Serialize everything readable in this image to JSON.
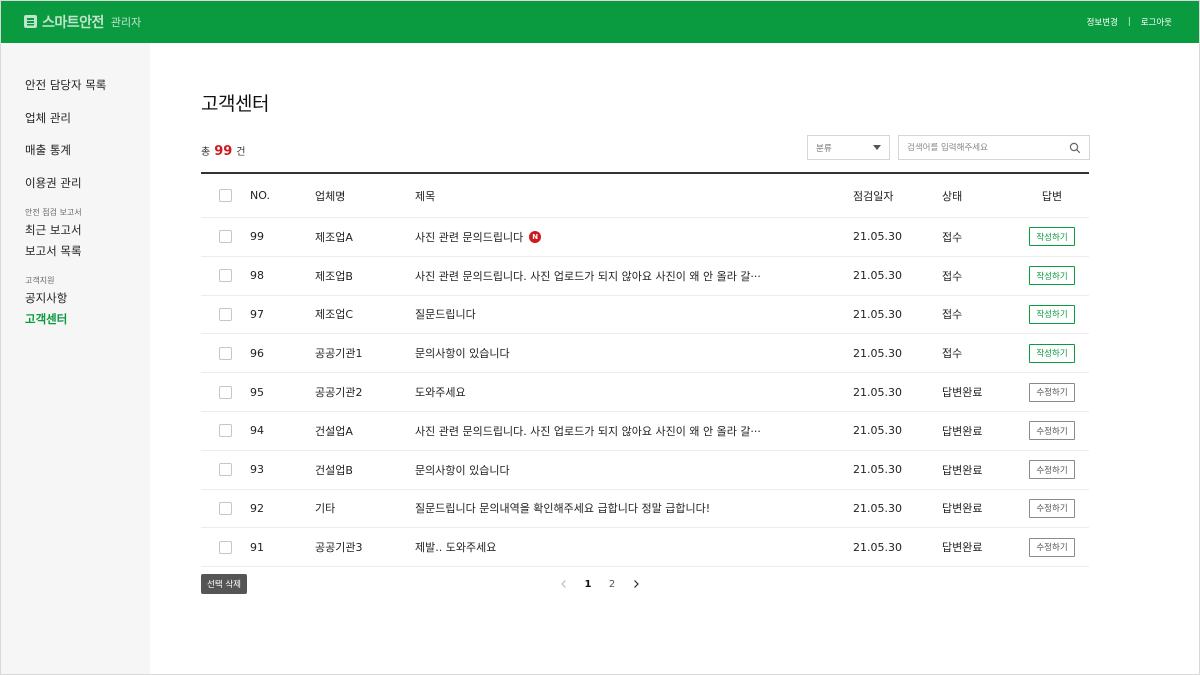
{
  "header": {
    "brand": "스마트안전",
    "brand_sub": "관리자",
    "links": {
      "profile": "정보변경",
      "separator": "|",
      "logout": "로그아웃"
    },
    "bg_color": "#0a9a3f"
  },
  "sidebar": {
    "items": [
      {
        "label": "안전 담당자 목록"
      },
      {
        "label": "업체 관리"
      },
      {
        "label": "매출 통계"
      },
      {
        "label": "이용권 관리"
      }
    ],
    "groups": [
      {
        "title": "안전 점검 보고서",
        "items": [
          "최근 보고서",
          "보고서 목록"
        ]
      },
      {
        "title": "고객지원",
        "items": [
          "공지사항",
          "고객센터"
        ]
      }
    ],
    "active": "고객센터"
  },
  "main": {
    "title": "고객센터",
    "total_prefix": "총",
    "total_count": "99",
    "total_suffix": "건",
    "filter_select": "분류",
    "search_placeholder": "검색어를 입력해주세요"
  },
  "table": {
    "columns": [
      "NO.",
      "업체명",
      "제목",
      "점검일자",
      "상태",
      "답변"
    ],
    "rows": [
      {
        "no": "99",
        "company": "제조업A",
        "title": "사진 관련 문의드립니다",
        "is_new": true,
        "new_badge": "N",
        "date": "21.05.30",
        "status": "접수",
        "action": "작성하기",
        "action_type": "write"
      },
      {
        "no": "98",
        "company": "제조업B",
        "title": "사진 관련 문의드립니다. 사진 업로드가 되지 않아요 사진이 왜 안 올라 갈···",
        "date": "21.05.30",
        "status": "접수",
        "action": "작성하기",
        "action_type": "write"
      },
      {
        "no": "97",
        "company": "제조업C",
        "title": "질문드립니다",
        "date": "21.05.30",
        "status": "접수",
        "action": "작성하기",
        "action_type": "write"
      },
      {
        "no": "96",
        "company": "공공기관1",
        "title": "문의사항이 있습니다",
        "date": "21.05.30",
        "status": "접수",
        "action": "작성하기",
        "action_type": "write"
      },
      {
        "no": "95",
        "company": "공공기관2",
        "title": "도와주세요",
        "date": "21.05.30",
        "status": "답변완료",
        "action": "수정하기",
        "action_type": "edit"
      },
      {
        "no": "94",
        "company": "건설업A",
        "title": "사진 관련 문의드립니다. 사진 업로드가 되지 않아요 사진이 왜 안 올라 갈···",
        "date": "21.05.30",
        "status": "답변완료",
        "action": "수정하기",
        "action_type": "edit"
      },
      {
        "no": "93",
        "company": "건설업B",
        "title": "문의사항이 있습니다",
        "date": "21.05.30",
        "status": "답변완료",
        "action": "수정하기",
        "action_type": "edit"
      },
      {
        "no": "92",
        "company": "기타",
        "title": "질문드립니다 문의내역을 확인해주세요 급합니다 정말 급합니다!",
        "date": "21.05.30",
        "status": "답변완료",
        "action": "수정하기",
        "action_type": "edit"
      },
      {
        "no": "91",
        "company": "공공기관3",
        "title": "제발.. 도와주세요",
        "date": "21.05.30",
        "status": "답변완료",
        "action": "수정하기",
        "action_type": "edit"
      }
    ]
  },
  "footer": {
    "delete_label": "선택 삭제",
    "pagination": {
      "pages": [
        "1",
        "2"
      ],
      "current": "1"
    }
  }
}
